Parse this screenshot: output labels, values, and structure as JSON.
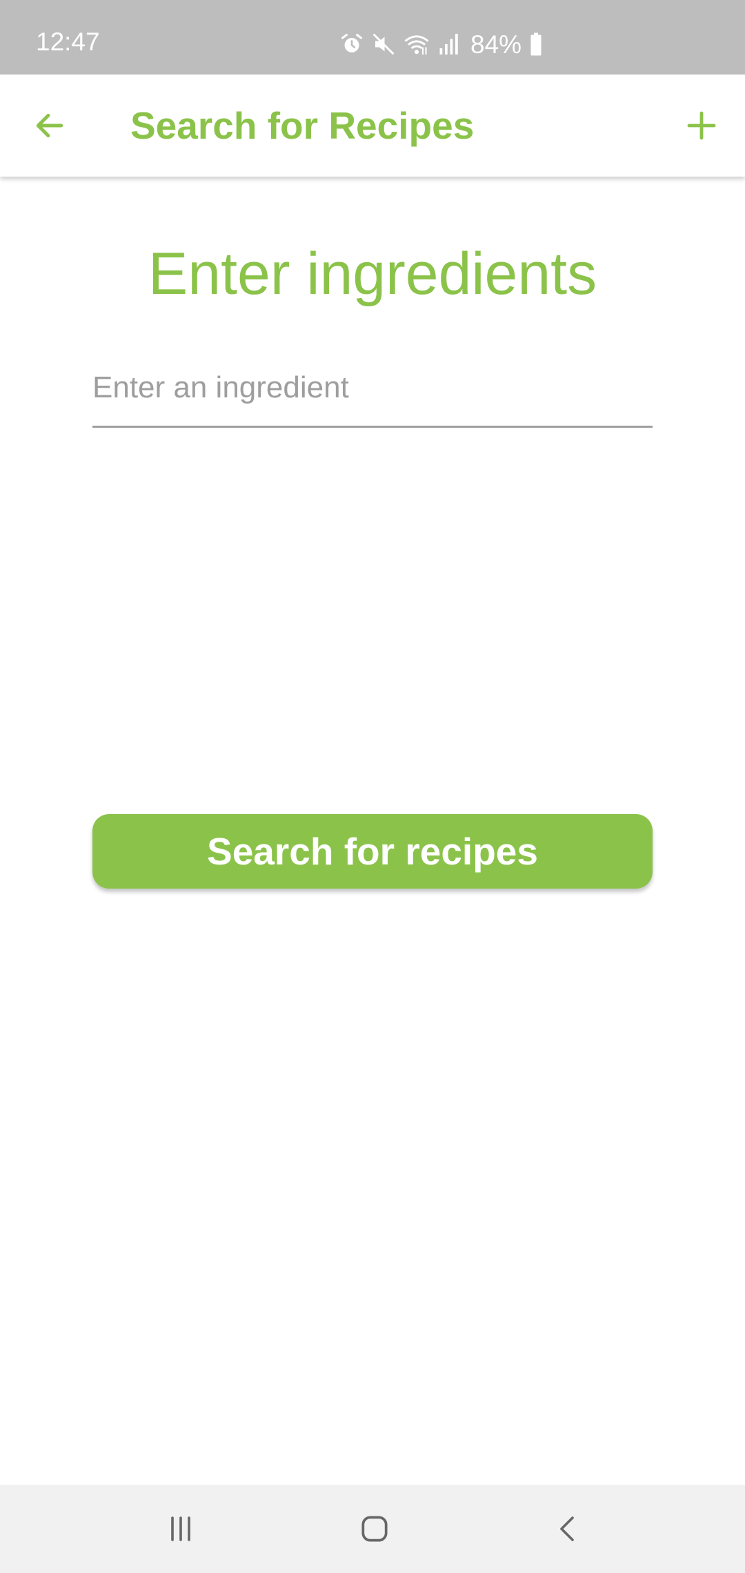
{
  "status_bar": {
    "time": "12:47",
    "battery": "84%",
    "icons": [
      "alarm-icon",
      "mute-icon",
      "wifi-icon",
      "signal-icon",
      "battery-icon"
    ]
  },
  "app_bar": {
    "title": "Search for Recipes",
    "back_icon": "arrow-left-icon",
    "add_icon": "plus-icon"
  },
  "main": {
    "heading": "Enter ingredients",
    "ingredient_input": {
      "placeholder": "Enter an ingredient",
      "value": ""
    },
    "search_button_label": "Search for recipes"
  },
  "nav_bar": {
    "buttons": [
      "recent-apps-icon",
      "home-icon",
      "back-icon"
    ]
  },
  "colors": {
    "accent": "#8bc34a",
    "status_bar_bg": "#bdbdbd",
    "nav_bar_bg": "#f1f1f1",
    "underline": "#9e9e9e"
  }
}
